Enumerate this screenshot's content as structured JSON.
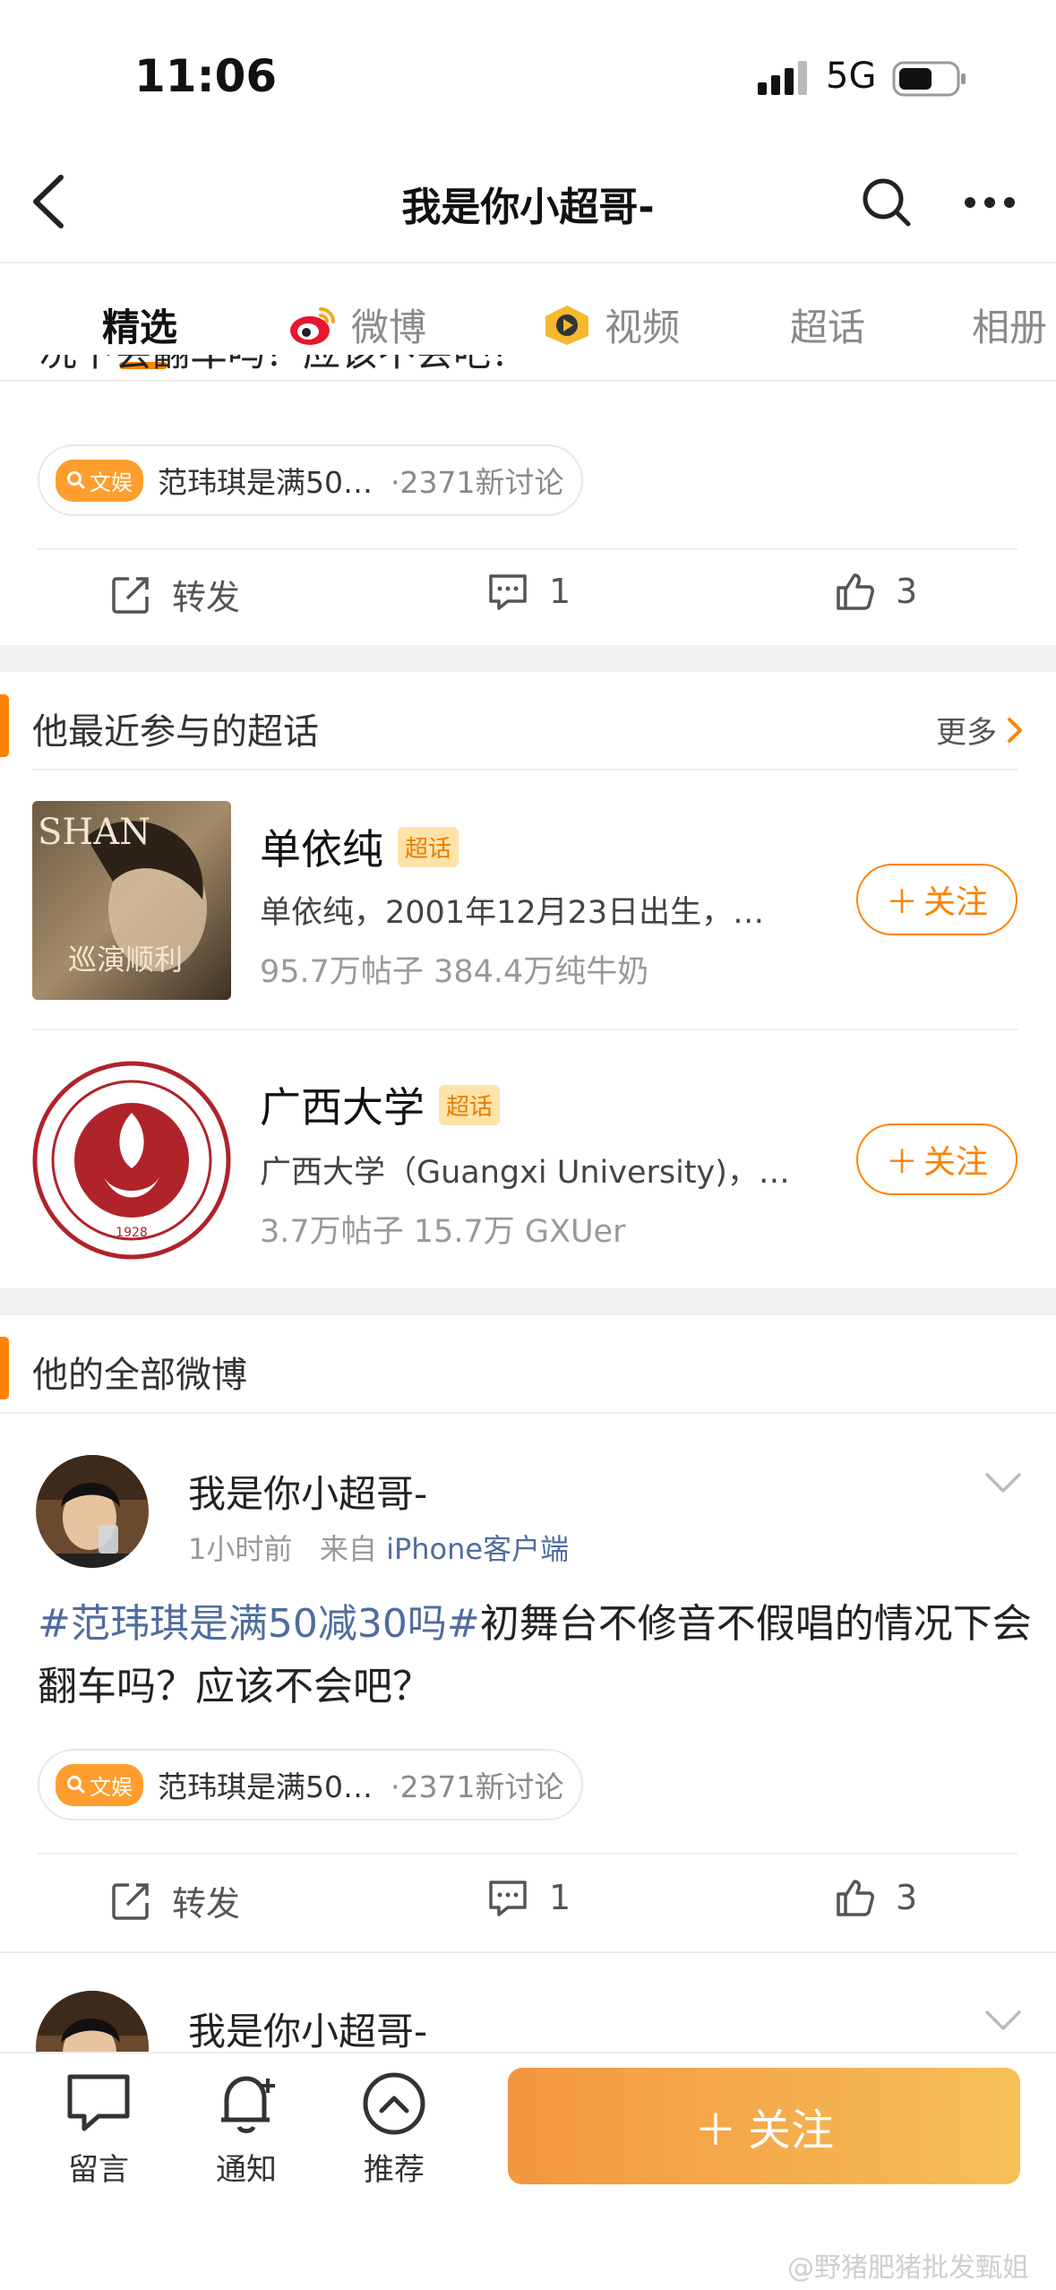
{
  "status": {
    "time": "11:06",
    "network": "5G"
  },
  "nav": {
    "title": "我是你小超哥-"
  },
  "tabs": [
    {
      "label": "精选",
      "icon": null
    },
    {
      "label": "微博",
      "icon": "weibo-logo-icon"
    },
    {
      "label": "视频",
      "icon": "video-play-icon"
    },
    {
      "label": "超话",
      "icon": null
    },
    {
      "label": "相册",
      "icon": null
    }
  ],
  "top_post": {
    "cutoff_text": "况下会翻车吗？应该不会吧？",
    "topic": {
      "tag": "文娱",
      "name": "范玮琪是满50…",
      "count": "·2371新讨论"
    },
    "actions": {
      "repost": "转发",
      "comments": "1",
      "likes": "3"
    }
  },
  "supertopics": {
    "title": "他最近参与的超话",
    "more": "更多",
    "items": [
      {
        "name": "单依纯",
        "badge": "超话",
        "desc": "单依纯，2001年12月23日出生，…",
        "stats": "95.7万帖子 384.4万纯牛奶",
        "follow": "关注",
        "thumb_text_top": "SHAN",
        "thumb_text_bottom": "巡演顺利"
      },
      {
        "name": "广西大学",
        "badge": "超话",
        "desc": "广西大学（Guangxi University)，…",
        "stats": "3.7万帖子 15.7万 GXUer",
        "follow": "关注"
      }
    ]
  },
  "all_posts": {
    "title": "他的全部微博",
    "posts": [
      {
        "user": "我是你小超哥-",
        "time": "1小时前",
        "from_label": "来自",
        "source": "iPhone客户端",
        "hashtag": "#范玮琪是满50减30吗#",
        "text": "初舞台不修音不假唱的情况下会翻车吗？应该不会吧？",
        "topic": {
          "tag": "文娱",
          "name": "范玮琪是满50…",
          "count": "·2371新讨论"
        },
        "actions": {
          "repost": "转发",
          "comments": "1",
          "likes": "3"
        }
      },
      {
        "user": "我是你小超哥-"
      }
    ]
  },
  "bottom_bar": {
    "message": "留言",
    "notify": "通知",
    "recommend": "推荐",
    "follow": "关注"
  },
  "watermark": "@野猪肥猪批发甄姐",
  "colors": {
    "accent": "#ff8200",
    "link": "#4f6d9e",
    "follow_gradient_start": "#f39640",
    "follow_gradient_end": "#f6c058"
  }
}
